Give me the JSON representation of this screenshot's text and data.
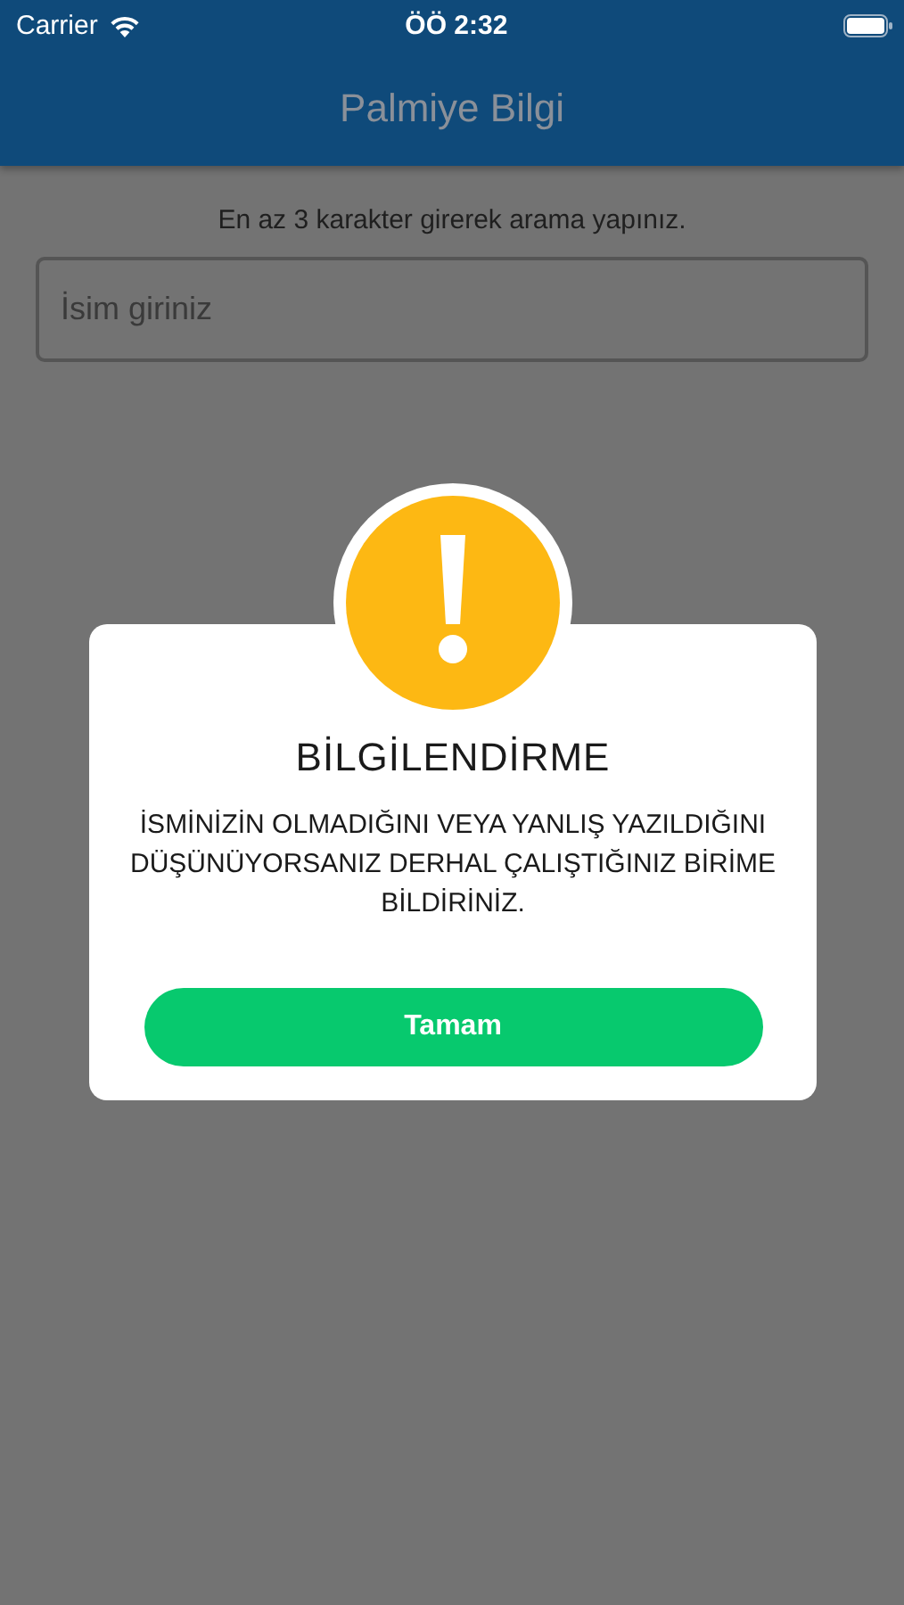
{
  "status_bar": {
    "carrier": "Carrier",
    "time": "ÖÖ 2:32"
  },
  "nav_bar": {
    "title": "Palmiye Bilgi"
  },
  "search": {
    "hint": "En az 3 karakter girerek arama yapınız.",
    "placeholder": "İsim giriniz"
  },
  "dialog": {
    "title": "BİLGİLENDİRME",
    "message": "İSMİNİZİN OLMADIĞINI VEYA YANLIŞ YAZILDIĞINI DÜŞÜNÜYORSANIZ DERHAL ÇALIŞTIĞINIZ BİRİME BİLDİRİNİZ.",
    "button": "Tamam"
  }
}
